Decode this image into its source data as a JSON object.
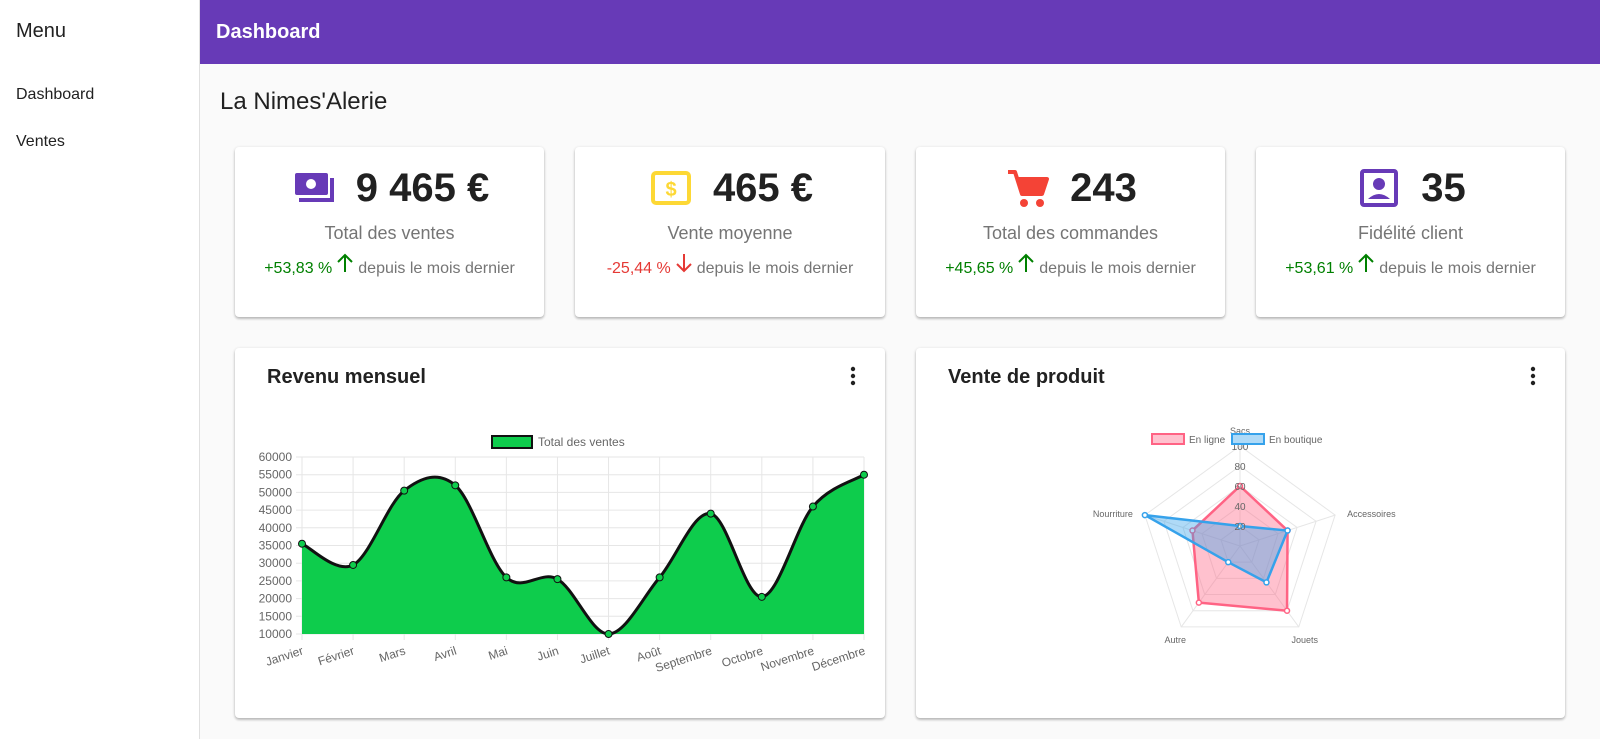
{
  "sidebar": {
    "title": "Menu",
    "items": [
      {
        "label": "Dashboard"
      },
      {
        "label": "Ventes"
      }
    ]
  },
  "header": {
    "title": "Dashboard"
  },
  "page": {
    "shop_name": "La Nimes'Alerie"
  },
  "stats": [
    {
      "icon": "money-icon",
      "value": "9 465 €",
      "label": "Total des ventes",
      "change": "+53,83 %",
      "direction": "up",
      "suffix": "depuis le mois dernier",
      "color": "#673ab7"
    },
    {
      "icon": "dollar-icon",
      "value": "465 €",
      "label": "Vente moyenne",
      "change": "-25,44 %",
      "direction": "down",
      "suffix": "depuis le mois dernier",
      "color": "#fdd835"
    },
    {
      "icon": "cart-icon",
      "value": "243",
      "label": "Total des commandes",
      "change": "+45,65 %",
      "direction": "up",
      "suffix": "depuis le mois dernier",
      "color": "#f44336"
    },
    {
      "icon": "account-box-icon",
      "value": "35",
      "label": "Fidélité client",
      "change": "+53,61 %",
      "direction": "up",
      "suffix": "depuis le mois dernier",
      "color": "#673ab7"
    }
  ],
  "charts": {
    "revenue": {
      "title": "Revenu mensuel"
    },
    "products": {
      "title": "Vente de produit"
    }
  },
  "chart_data": [
    {
      "type": "area",
      "categories": [
        "Janvier",
        "Février",
        "Mars",
        "Avril",
        "Mai",
        "Juin",
        "Juillet",
        "Août",
        "Septembre",
        "Octobre",
        "Novembre",
        "Décembre"
      ],
      "series": [
        {
          "name": "Total des ventes",
          "values": [
            35500,
            29500,
            50500,
            52000,
            26000,
            25500,
            10000,
            26000,
            44000,
            20500,
            46000,
            55000
          ],
          "color": "#0ecc4c"
        }
      ],
      "ylim": [
        10000,
        60000
      ],
      "yticks": [
        10000,
        15000,
        20000,
        25000,
        30000,
        35000,
        40000,
        45000,
        50000,
        55000,
        60000
      ],
      "grid": true,
      "legend": "top"
    },
    {
      "type": "radar",
      "axes": [
        "Sacs",
        "Accessoires",
        "Jouets",
        "Autre",
        "Nourriture"
      ],
      "series": [
        {
          "name": "En ligne",
          "values": [
            60,
            50,
            80,
            70,
            50
          ],
          "color": "#ff6384"
        },
        {
          "name": "En boutique",
          "values": [
            20,
            50,
            45,
            20,
            100
          ],
          "color": "#36a2eb"
        }
      ],
      "rlim": [
        0,
        100
      ],
      "rticks": [
        20,
        40,
        60,
        80,
        100
      ],
      "legend": "top"
    }
  ]
}
